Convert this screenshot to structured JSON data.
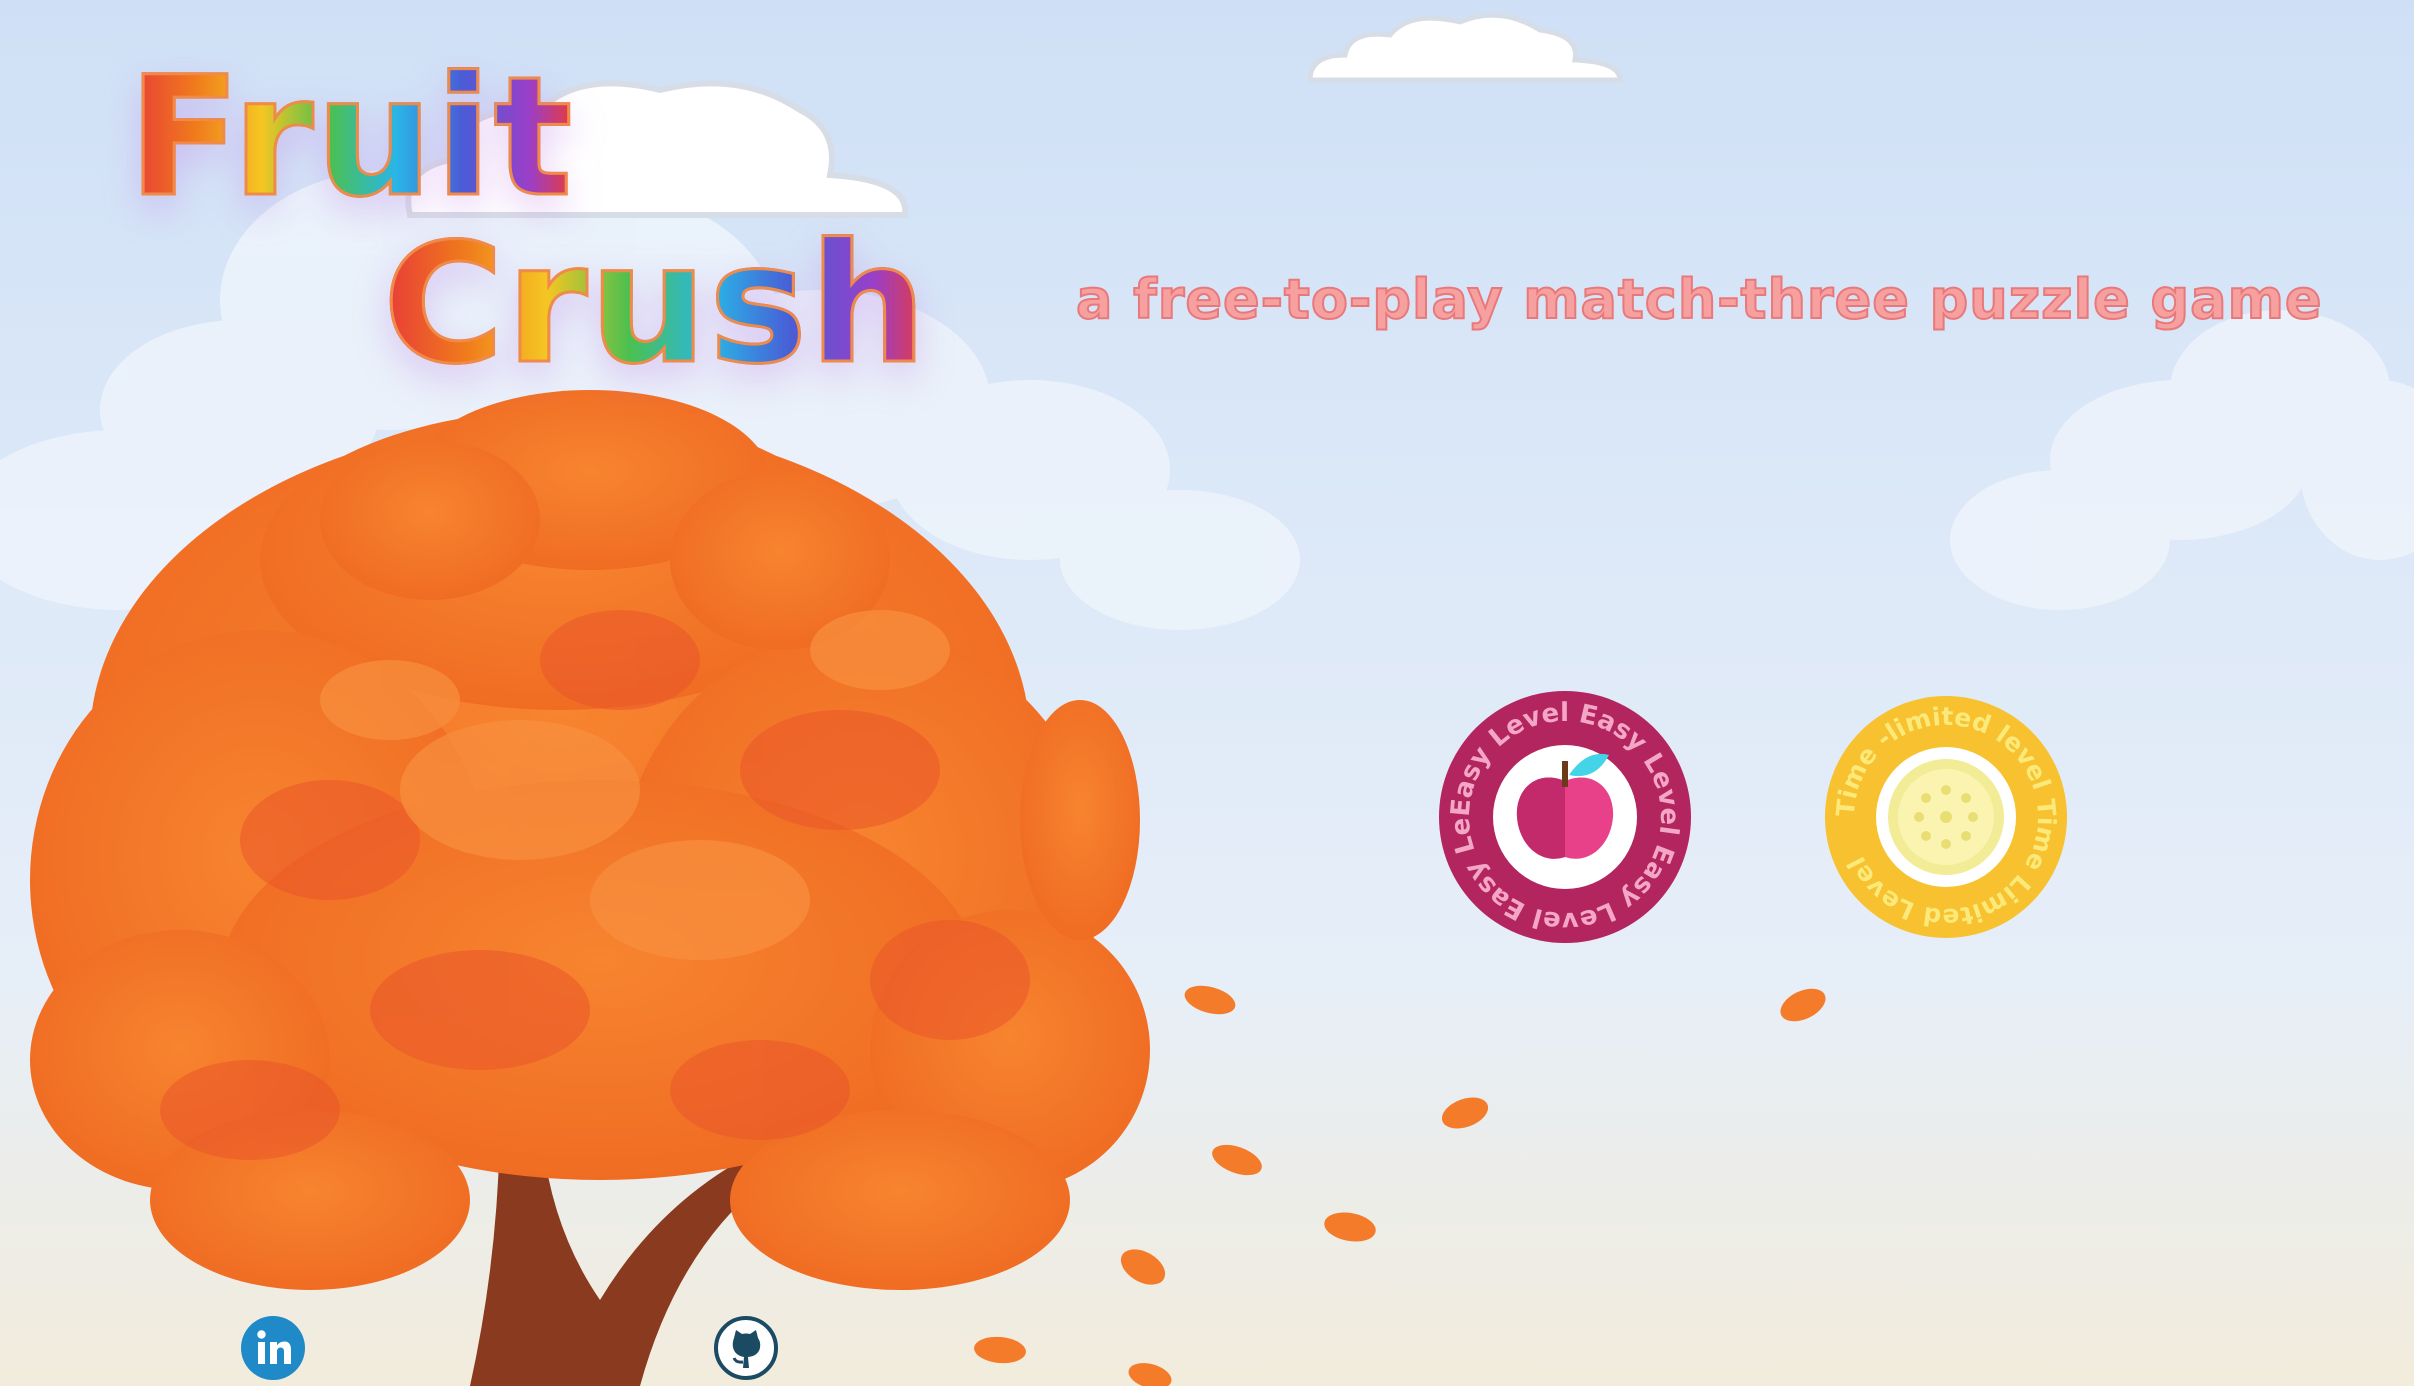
{
  "title": {
    "line1": "Fruit",
    "line2": "Crush"
  },
  "tagline": "a free-to-play match-three puzzle game",
  "levels": [
    {
      "id": "easy",
      "ring_text": "Easy Level   Easy Level   Easy Level   Easy Level   ",
      "icon": "apple-icon",
      "color": "#b3255e"
    },
    {
      "id": "time",
      "ring_text": "Time -limited level   Time Limited Level   ",
      "icon": "lemon-slice-icon",
      "color": "#f7c12f"
    }
  ],
  "social": [
    {
      "name": "linkedin",
      "icon": "linkedin-icon",
      "color": "#1f8ac7"
    },
    {
      "name": "github",
      "icon": "github-icon",
      "color": "#1b4a63"
    }
  ],
  "colors": {
    "foliage": "#f2711f",
    "trunk": "#8a3a1f",
    "tagline": "#f6a1a0"
  }
}
